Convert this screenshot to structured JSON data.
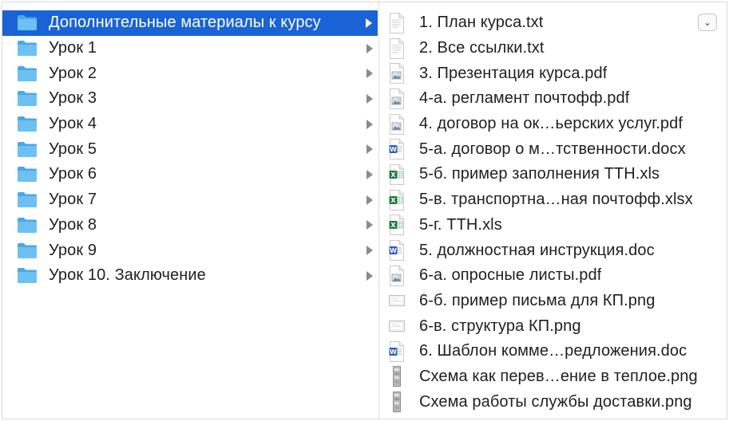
{
  "folders": [
    {
      "label": "Дополнительные материалы к курсу",
      "selected": true
    },
    {
      "label": "Урок 1"
    },
    {
      "label": "Урок 2"
    },
    {
      "label": "Урок 3"
    },
    {
      "label": "Урок 4"
    },
    {
      "label": "Урок 5"
    },
    {
      "label": "Урок 6"
    },
    {
      "label": "Урок 7"
    },
    {
      "label": "Урок 8"
    },
    {
      "label": "Урок 9"
    },
    {
      "label": "Урок 10. Заключение"
    }
  ],
  "files": [
    {
      "label": "1. План курса.txt",
      "icon": "txt-file-icon"
    },
    {
      "label": "2. Все ссылки.txt",
      "icon": "txt-file-icon"
    },
    {
      "label": "3. Презентация курса.pdf",
      "icon": "pdf-file-icon"
    },
    {
      "label": "4-а. регламент почтофф.pdf",
      "icon": "pdf-file-icon"
    },
    {
      "label": "4. договор на ок…ьерских услуг.pdf",
      "icon": "pdf-file-icon"
    },
    {
      "label": "5-а. договор о м…тственности.docx",
      "icon": "word-file-icon"
    },
    {
      "label": "5-б. пример заполнения ТТН.xls",
      "icon": "excel-file-icon"
    },
    {
      "label": "5-в. транспортна…ная почтофф.xlsx",
      "icon": "excel-file-icon"
    },
    {
      "label": "5-г. ТТН.xls",
      "icon": "excel-file-icon"
    },
    {
      "label": "5. должностная инструкция.doc",
      "icon": "word-file-icon"
    },
    {
      "label": "6-а. опросные листы.pdf",
      "icon": "pdf-file-icon"
    },
    {
      "label": "6-б. пример письма для КП.png",
      "icon": "png-file-icon"
    },
    {
      "label": "6-в. структура КП.png",
      "icon": "png-file-icon"
    },
    {
      "label": "6. Шаблон комме…редложения.doc",
      "icon": "word-file-icon"
    },
    {
      "label": "Схема как перев…ение в теплое.png",
      "icon": "png-tall-file-icon"
    },
    {
      "label": "Схема работы службы доставки.png",
      "icon": "png-tall-file-icon"
    }
  ],
  "dropdown": {
    "glyph": "⌄"
  },
  "colors": {
    "selection": "#1a63d6",
    "folder": "#5eb8ef",
    "word": "#2b5cb8",
    "excel": "#1e7a3e"
  }
}
